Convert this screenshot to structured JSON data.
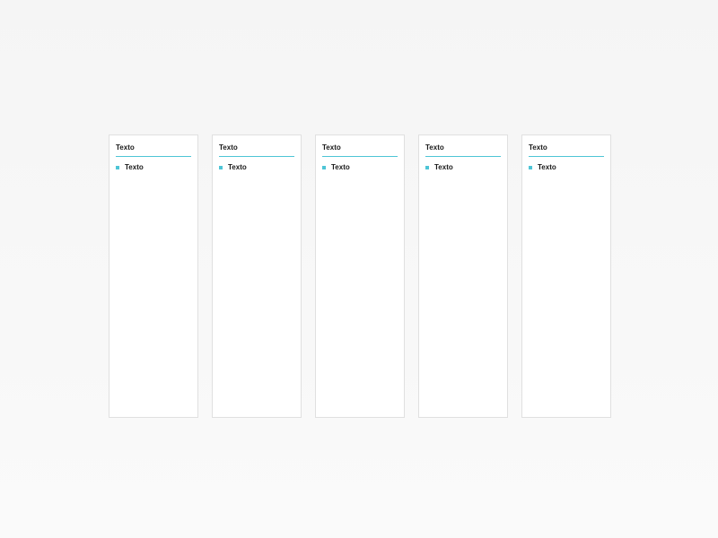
{
  "accent_color": "#4ec5d6",
  "columns": [
    {
      "title": "Texto",
      "items": [
        "Texto"
      ]
    },
    {
      "title": "Texto",
      "items": [
        "Texto"
      ]
    },
    {
      "title": "Texto",
      "items": [
        "Texto"
      ]
    },
    {
      "title": "Texto",
      "items": [
        "Texto"
      ]
    },
    {
      "title": "Texto",
      "items": [
        "Texto"
      ]
    }
  ]
}
